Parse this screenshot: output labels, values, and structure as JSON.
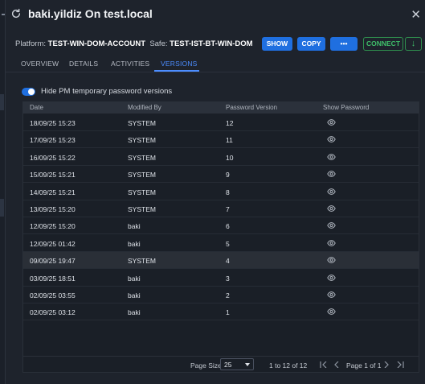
{
  "window": {
    "title": "baki.yildiz On test.local"
  },
  "account": {
    "platform_label": "Platform:",
    "platform_value": "TEST-WIN-DOM-ACCOUNT",
    "safe_label": "Safe:",
    "safe_value": "TEST-IST-BT-WIN-DOM"
  },
  "actions": {
    "show": "SHOW",
    "copy": "COPY",
    "more": "•••",
    "connect": "CONNECT",
    "download": "↓"
  },
  "tabs": [
    {
      "label": "OVERVIEW",
      "active": false
    },
    {
      "label": "DETAILS",
      "active": false
    },
    {
      "label": "ACTIVITIES",
      "active": false
    },
    {
      "label": "VERSIONS",
      "active": true
    }
  ],
  "toggle": {
    "label": "Hide PM temporary password versions",
    "checked": true
  },
  "table": {
    "columns": [
      "Date",
      "Modified By",
      "Password Version",
      "Show Password"
    ],
    "rows": [
      {
        "date": "18/09/25 15:23",
        "modified_by": "SYSTEM",
        "version": "12"
      },
      {
        "date": "17/09/25 15:23",
        "modified_by": "SYSTEM",
        "version": "11"
      },
      {
        "date": "16/09/25 15:22",
        "modified_by": "SYSTEM",
        "version": "10"
      },
      {
        "date": "15/09/25 15:21",
        "modified_by": "SYSTEM",
        "version": "9"
      },
      {
        "date": "14/09/25 15:21",
        "modified_by": "SYSTEM",
        "version": "8"
      },
      {
        "date": "13/09/25 15:20",
        "modified_by": "SYSTEM",
        "version": "7"
      },
      {
        "date": "12/09/25 15:20",
        "modified_by": "baki",
        "version": "6"
      },
      {
        "date": "12/09/25 01:42",
        "modified_by": "baki",
        "version": "5"
      },
      {
        "date": "09/09/25 19:47",
        "modified_by": "SYSTEM",
        "version": "4"
      },
      {
        "date": "03/09/25 18:51",
        "modified_by": "baki",
        "version": "3"
      },
      {
        "date": "02/09/25 03:55",
        "modified_by": "baki",
        "version": "2"
      },
      {
        "date": "02/09/25 03:12",
        "modified_by": "baki",
        "version": "1"
      }
    ],
    "highlighted_row": 8
  },
  "pagination": {
    "page_size_label": "Page Size:",
    "page_size_value": "25",
    "range_text": "1 to 12 of 12",
    "page_text": "Page 1 of 1",
    "first_icon": "first-page-icon",
    "prev_icon": "prev-page-icon",
    "next_icon": "next-page-icon",
    "last_icon": "last-page-icon"
  },
  "colors": {
    "accent": "#1f6fe0",
    "tab_active": "#4c8dff",
    "connect_green": "#3fbf6a",
    "background": "#1e232c"
  }
}
